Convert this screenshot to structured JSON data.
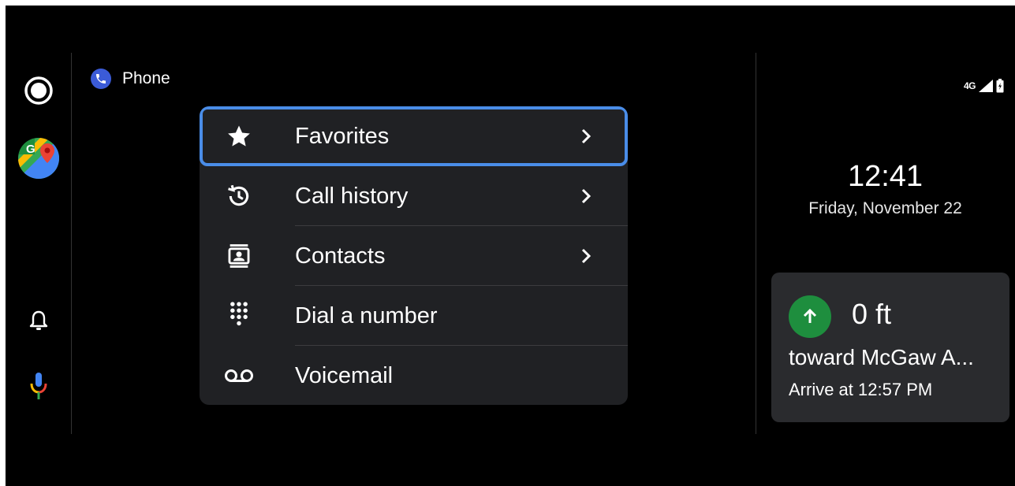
{
  "app": {
    "title": "Phone"
  },
  "menu": {
    "items": [
      {
        "label": "Favorites",
        "icon": "star-icon",
        "has_chevron": true,
        "focused": true
      },
      {
        "label": "Call history",
        "icon": "history-icon",
        "has_chevron": true
      },
      {
        "label": "Contacts",
        "icon": "contacts-icon",
        "has_chevron": true
      },
      {
        "label": "Dial a number",
        "icon": "dialpad-icon",
        "has_chevron": false
      },
      {
        "label": "Voicemail",
        "icon": "voicemail-icon",
        "has_chevron": false
      }
    ]
  },
  "status": {
    "network": "4G"
  },
  "clock": {
    "time": "12:41",
    "date": "Friday, November 22"
  },
  "navigation": {
    "distance": "0 ft",
    "street": "toward McGaw A...",
    "arrival": "Arrive at 12:57 PM"
  },
  "colors": {
    "background": "#000000",
    "menu_background": "#202124",
    "focus_outline": "#4a8de8",
    "nav_card": "#2a2b2e",
    "turn_green": "#1e8e3e",
    "phone_badge": "#3b5bd8"
  }
}
